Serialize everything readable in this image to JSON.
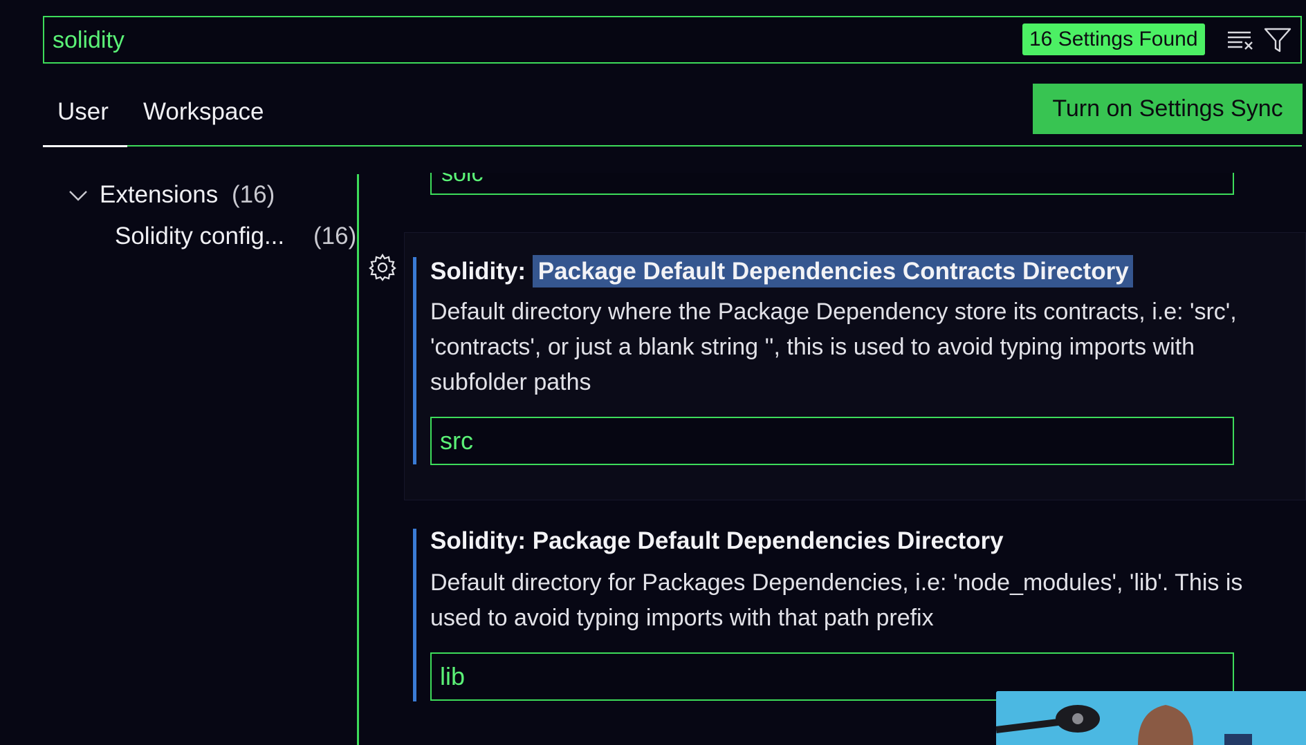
{
  "search": {
    "value": "solidity",
    "found_label": "16 Settings Found"
  },
  "tabs": [
    {
      "label": "User"
    },
    {
      "label": "Workspace"
    }
  ],
  "sync_button_label": "Turn on Settings Sync",
  "tree": {
    "extensions": {
      "label": "Extensions",
      "count": "(16)"
    },
    "solidity": {
      "label": "Solidity config...",
      "count": "(16)"
    }
  },
  "partial_input_value": "solc",
  "settings": [
    {
      "prefix": "Solidity: ",
      "title": "Package Default Dependencies Contracts Directory",
      "description": "Default directory where the Package Dependency store its contracts, i.e: 'src', 'contracts', or just a blank string '', this is used to avoid typing imports with subfolder paths",
      "value": "src"
    },
    {
      "prefix": "Solidity: ",
      "title": "Package Default Dependencies Directory",
      "description": "Default directory for Packages Dependencies, i.e: 'node_modules', 'lib'. This is used to avoid typing imports with that path prefix",
      "value": "lib"
    }
  ],
  "icons": {
    "clear": "clear-filter-icon",
    "filter": "filter-icon",
    "gear": "gear-icon",
    "chevron": "chevron-down-icon"
  },
  "colors": {
    "accent_green": "#3ddc5a",
    "text_green": "#5bf277",
    "badge_green": "#4cf064",
    "modified_blue": "#3a7bd5",
    "highlight": "#35568f",
    "background": "#070714"
  }
}
